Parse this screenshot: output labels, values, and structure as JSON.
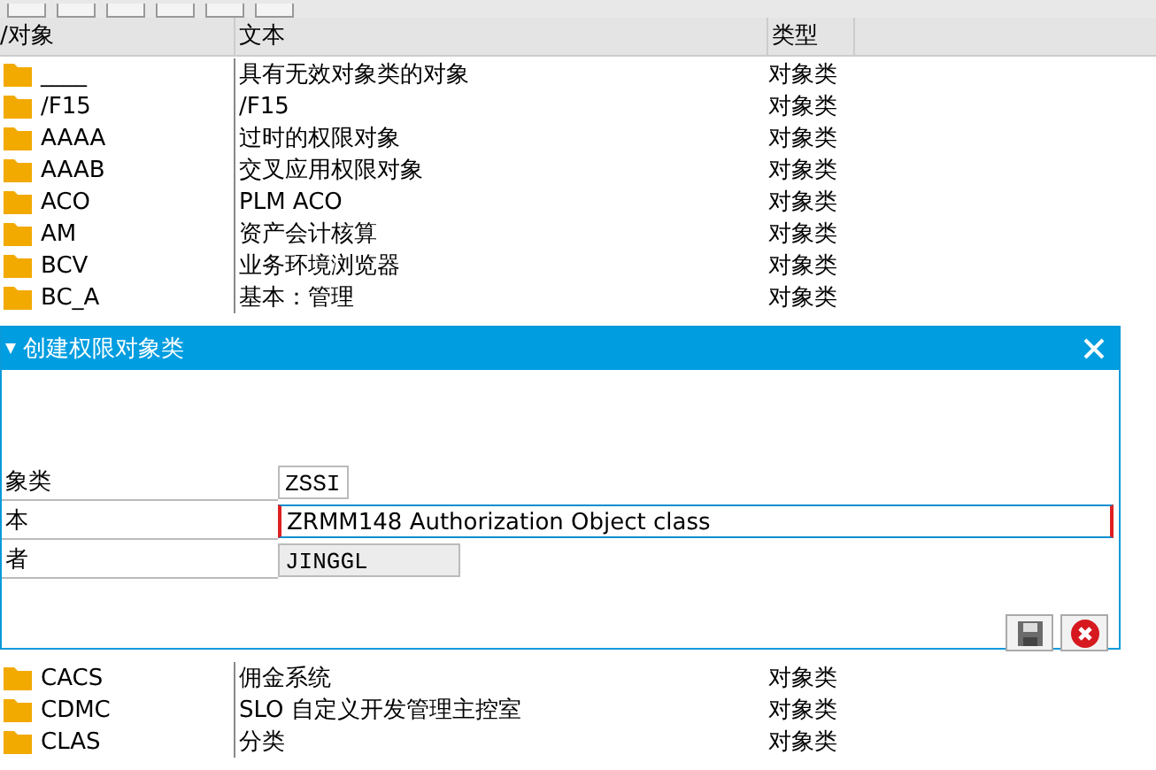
{
  "list": {
    "columns": [
      "/对象",
      "文本",
      "类型"
    ],
    "rows_top": [
      {
        "object": "____",
        "text": "具有无效对象类的对象",
        "type": "对象类"
      },
      {
        "object": "/F15",
        "text": "/F15",
        "type": "对象类"
      },
      {
        "object": "AAAA",
        "text": "过时的权限对象",
        "type": "对象类"
      },
      {
        "object": "AAAB",
        "text": "交叉应用权限对象",
        "type": "对象类"
      },
      {
        "object": "ACO",
        "text": "PLM ACO",
        "type": "对象类"
      },
      {
        "object": "AM",
        "text": "资产会计核算",
        "type": "对象类"
      },
      {
        "object": "BCV",
        "text": "业务环境浏览器",
        "type": "对象类"
      },
      {
        "object": "BC_A",
        "text": "基本：管理",
        "type": "对象类"
      }
    ],
    "rows_bottom": [
      {
        "object": "CACS",
        "text": "佣金系统",
        "type": "对象类"
      },
      {
        "object": "CDMC",
        "text": "SLO 自定义开发管理主控室",
        "type": "对象类"
      },
      {
        "object": "CLAS",
        "text": "分类",
        "type": "对象类"
      }
    ]
  },
  "dialog": {
    "title": "创建权限对象类",
    "fields": [
      {
        "label": "象类",
        "value": "ZSSI",
        "kind": "short",
        "disabled": false,
        "required": false
      },
      {
        "label": "本",
        "value": "ZRMM148 Authorization Object class",
        "kind": "long",
        "disabled": false,
        "required": true
      },
      {
        "label": "者",
        "value": "JINGGL",
        "kind": "medium",
        "disabled": true,
        "required": false
      }
    ]
  }
}
